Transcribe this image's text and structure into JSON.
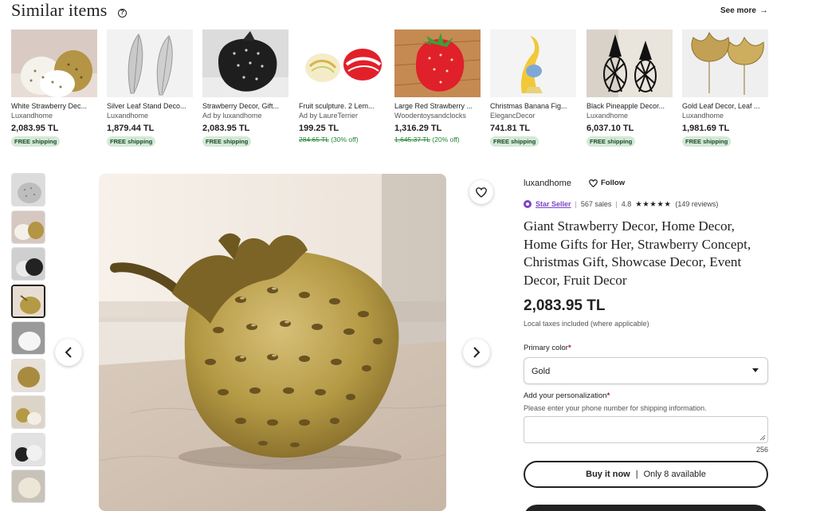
{
  "similar": {
    "title": "Similar items",
    "see_more": "See more",
    "items": [
      {
        "title": "White Strawberry Dec...",
        "shop": "Luxandhome",
        "price": "2,083.95 TL",
        "shipping": "FREE shipping",
        "icon": "white-strawberries"
      },
      {
        "title": "Silver Leaf Stand Deco...",
        "shop": "Luxandhome",
        "price": "1,879.44 TL",
        "shipping": "FREE shipping",
        "icon": "silver-leaves"
      },
      {
        "title": "Strawberry Decor, Gift...",
        "shop": "Ad by luxandhome",
        "price": "2,083.95 TL",
        "shipping": "FREE shipping",
        "icon": "black-strawberry"
      },
      {
        "title": "Fruit sculpture. 2 Lem...",
        "shop": "Ad by LaureTerrier",
        "price": "199.25 TL",
        "original": "284.65 TL",
        "discount": "(30% off)",
        "icon": "fruit-sculpture"
      },
      {
        "title": "Large Red Strawberry ...",
        "shop": "Woodentoysandclocks",
        "price": "1,316.29 TL",
        "original": "1,645.37 TL",
        "discount": "(20% off)",
        "icon": "red-strawberry"
      },
      {
        "title": "Christmas Banana Fig...",
        "shop": "ElegancDecor",
        "price": "741.81 TL",
        "shipping": "FREE shipping",
        "icon": "banana-figure"
      },
      {
        "title": "Black Pineapple Decor...",
        "shop": "Luxandhome",
        "price": "6,037.10 TL",
        "shipping": "FREE shipping",
        "icon": "black-pineapple"
      },
      {
        "title": "Gold Leaf Decor, Leaf ...",
        "shop": "Luxandhome",
        "price": "1,981.69 TL",
        "shipping": "FREE shipping",
        "icon": "gold-leaves"
      }
    ]
  },
  "listing": {
    "shop_name": "luxandhome",
    "follow": "Follow",
    "star_seller": "Star Seller",
    "sales": "567 sales",
    "rating": "4.8",
    "stars": "★★★★★",
    "reviews": "(149 reviews)",
    "title": "Giant Strawberry Decor, Home Decor, Home Gifts for Her, Strawberry Concept, Christmas Gift, Showcase Decor, Event Decor, Fruit Decor",
    "price": "2,083.95 TL",
    "taxes": "Local taxes included (where applicable)",
    "color_label": "Primary color",
    "color_value": "Gold",
    "required_mark": "*",
    "personalization_label": "Add your personalization",
    "personalization_hint": "Please enter your phone number for shipping information.",
    "char_count": "256",
    "buy_now": "Buy it now",
    "availability": "Only 8 available"
  },
  "colors": {
    "gold": "#b59a45",
    "free_shipping_bg": "#d4e9d7",
    "sale_green": "#258635",
    "star_seller": "#7d43c7",
    "required": "#a61a2e"
  }
}
